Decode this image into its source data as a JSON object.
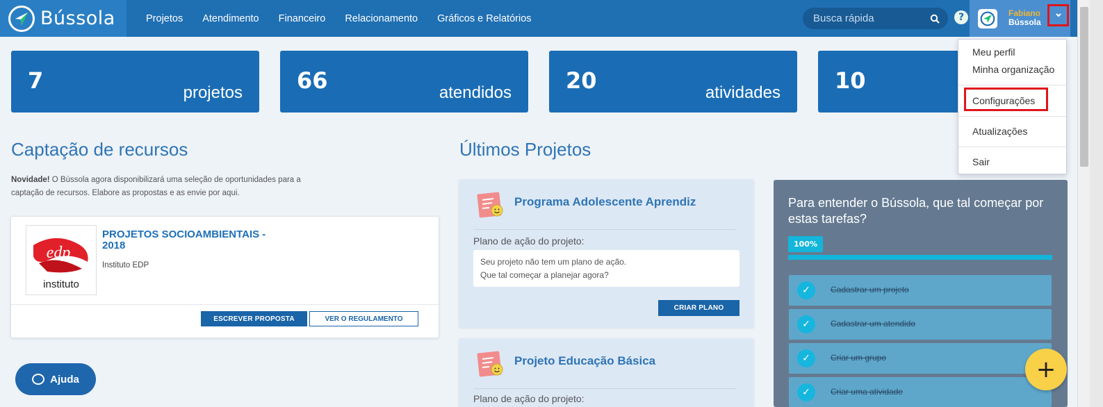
{
  "brand": {
    "name": "Bússola"
  },
  "nav": {
    "items": [
      "Projetos",
      "Atendimento",
      "Financeiro",
      "Relacionamento",
      "Gráficos e Relatórios"
    ]
  },
  "search": {
    "placeholder": "Busca rápida"
  },
  "help": {
    "label": "?"
  },
  "user": {
    "first_name": "Fabiano",
    "org": "Bússola"
  },
  "stats": [
    {
      "value": "7",
      "label": "projetos"
    },
    {
      "value": "66",
      "label": "atendidos"
    },
    {
      "value": "20",
      "label": "atividades"
    },
    {
      "value": "10",
      "label": ""
    }
  ],
  "captacao": {
    "heading": "Captação de recursos",
    "intro_bold": "Novidade!",
    "intro_text": " O Bússola agora disponibilizará uma seleção de oportunidades para a captação de recursos. Elabore as propostas e as envie por aqui.",
    "opportunity": {
      "logo_word": "edp",
      "logo_caption": "instituto",
      "title": "PROJETOS SOCIOAMBIENTAIS - 2018",
      "org": "Instituto EDP",
      "write_label": "ESCREVER PROPOSTA",
      "rules_label": "VER O REGULAMENTO"
    }
  },
  "projects": {
    "heading": "Últimos Projetos",
    "items": [
      {
        "title": "Programa Adolescente Aprendiz",
        "plan_label": "Plano de ação do projeto:",
        "plan_line1": "Seu projeto não tem um plano de ação.",
        "plan_line2": "Que tal começar a planejar agora?",
        "create_label": "CRIAR PLANO"
      },
      {
        "title": "Projeto Educação Básica",
        "plan_label": "Plano de ação do projeto:"
      }
    ]
  },
  "onboarding": {
    "title": "Para entender o Bússola, que tal começar por estas tarefas?",
    "progress": "100%",
    "progress_value": 1.0,
    "tasks": [
      "Cadastrar um projeto",
      "Cadastrar um atendido",
      "Criar um grupo",
      "Criar uma atividade"
    ]
  },
  "user_menu": {
    "items": [
      "Meu perfil",
      "Minha organização",
      "Configurações",
      "Atualizações",
      "Sair"
    ]
  },
  "ajuda": {
    "label": "Ajuda"
  },
  "fab": {
    "label": "+"
  },
  "colors": {
    "primary": "#1a6db5",
    "accent": "#f9d148",
    "highlight": "#e0151b",
    "onboarding": "#657a91"
  }
}
